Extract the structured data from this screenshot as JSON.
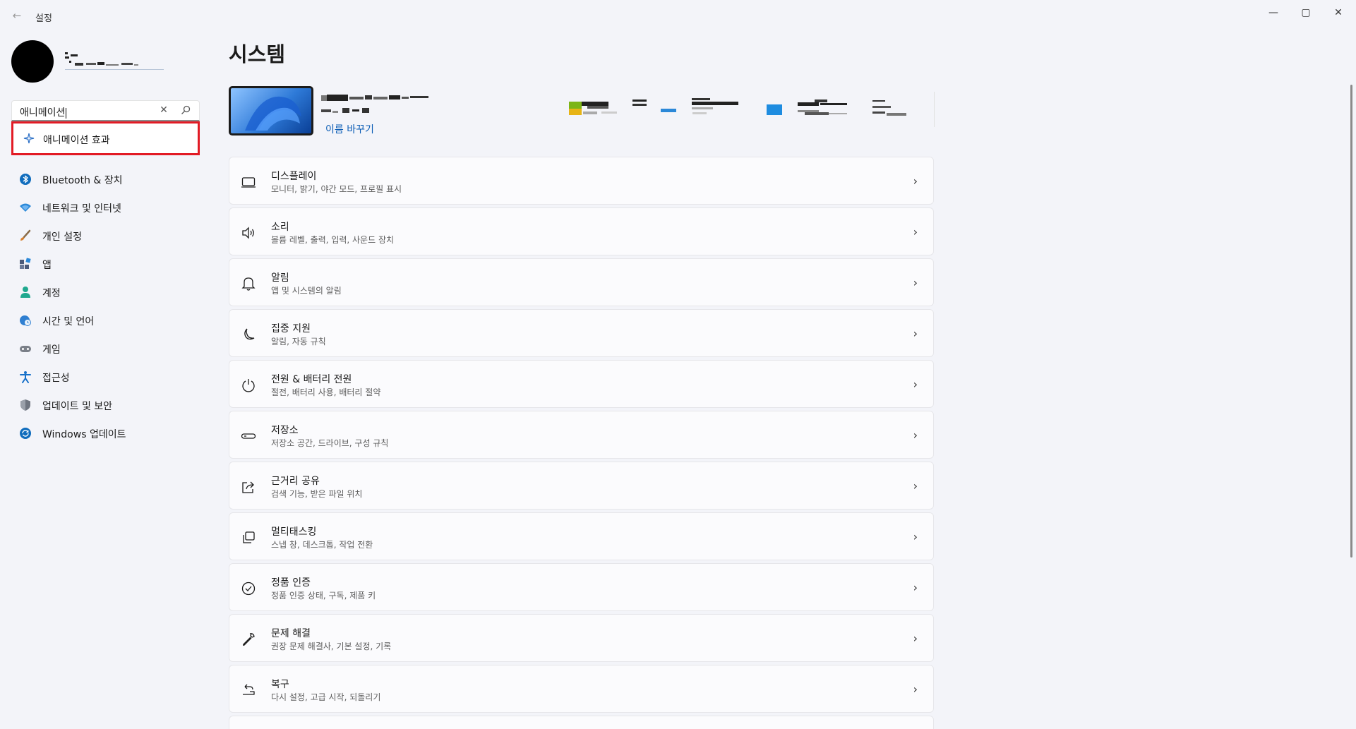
{
  "window": {
    "title": "설정",
    "back_glyph": "←",
    "minimize_glyph": "—",
    "maximize_glyph": "▢",
    "close_glyph": "✕"
  },
  "search": {
    "value": "애니메이션",
    "clear_glyph": "✕",
    "suggestion": "애니메이션 효과"
  },
  "sidebar": {
    "items": [
      {
        "label": "Bluetooth & 장치",
        "icon": "bluetooth-icon",
        "color": "#0f6cbd"
      },
      {
        "label": "네트워크 및 인터넷",
        "icon": "wifi-icon",
        "color": "#2b88d8"
      },
      {
        "label": "개인 설정",
        "icon": "brush-icon",
        "color": "#d67f2d"
      },
      {
        "label": "앱",
        "icon": "apps-icon",
        "color": "#4a5a7a"
      },
      {
        "label": "계정",
        "icon": "person-icon",
        "color": "#1fa88f"
      },
      {
        "label": "시간 및 언어",
        "icon": "globe-clock-icon",
        "color": "#2f7fd1"
      },
      {
        "label": "게임",
        "icon": "gamepad-icon",
        "color": "#7a7f88"
      },
      {
        "label": "접근성",
        "icon": "accessibility-icon",
        "color": "#1670c9"
      },
      {
        "label": "업데이트 및 보안",
        "icon": "shield-icon",
        "color": "#6f7580"
      },
      {
        "label": "Windows 업데이트",
        "icon": "sync-icon",
        "color": "#0f6cbd"
      }
    ]
  },
  "main": {
    "title": "시스템",
    "rename_label": "이름 바꾸기",
    "cards": [
      {
        "title": "디스플레이",
        "subtitle": "모니터, 밝기, 야간 모드, 프로필 표시",
        "icon": "display-icon"
      },
      {
        "title": "소리",
        "subtitle": "볼륨 레벨, 출력, 입력, 사운드 장치",
        "icon": "speaker-icon"
      },
      {
        "title": "알림",
        "subtitle": "앱 및 시스템의 알림",
        "icon": "bell-icon"
      },
      {
        "title": "집중 지원",
        "subtitle": "알림, 자동 규칙",
        "icon": "moon-icon"
      },
      {
        "title": "전원 & 배터리 전원",
        "subtitle": "절전, 배터리 사용, 배터리 절약",
        "icon": "power-icon"
      },
      {
        "title": "저장소",
        "subtitle": "저장소 공간, 드라이브, 구성 규칙",
        "icon": "storage-icon"
      },
      {
        "title": "근거리 공유",
        "subtitle": "검색 기능, 받은 파일 위치",
        "icon": "share-icon"
      },
      {
        "title": "멀티태스킹",
        "subtitle": "스냅 창, 데스크톱, 작업 전환",
        "icon": "multitask-icon"
      },
      {
        "title": "정품 인증",
        "subtitle": "정품 인증 상태, 구독, 제품 키",
        "icon": "check-circle-icon"
      },
      {
        "title": "문제 해결",
        "subtitle": "권장 문제 해결사, 기본 설정, 기록",
        "icon": "wrench-icon"
      },
      {
        "title": "복구",
        "subtitle": "다시 설정, 고급 시작, 되돌리기",
        "icon": "recovery-icon"
      }
    ],
    "chevron": "›"
  }
}
